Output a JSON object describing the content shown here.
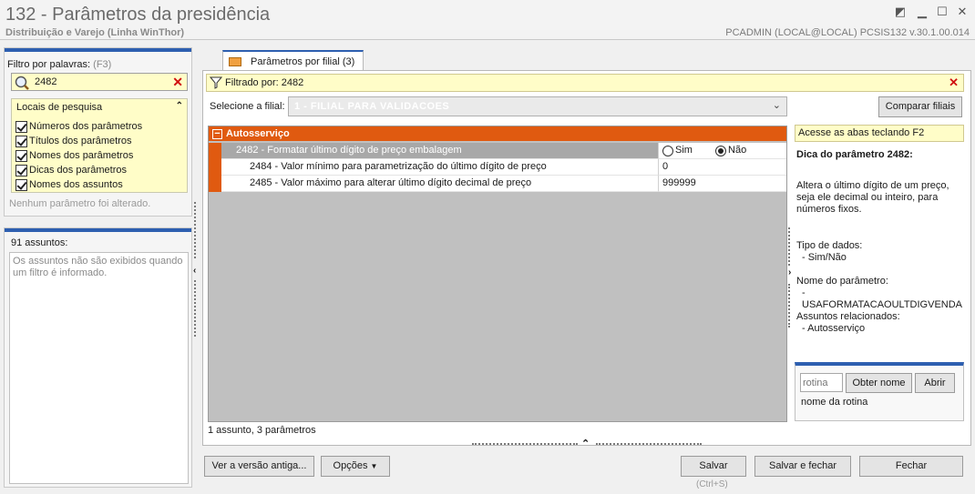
{
  "window": {
    "title": "132 - Parâmetros da presidência",
    "subtitle": "Distribuição e Varejo (Linha WinThor)",
    "user_info": "PCADMIN (LOCAL@LOCAL)   PCSIS132  v.30.1.00.014",
    "controls": [
      "restore-icon",
      "minimize-icon",
      "maximize-icon",
      "close-icon"
    ]
  },
  "left": {
    "filter_label": "Filtro por palavras:",
    "filter_hint": "(F3)",
    "search_value": "2482",
    "locais_title": "Locais de pesquisa",
    "locais_items": [
      "Números dos parâmetros",
      "Títulos dos parâmetros",
      "Nomes dos parâmetros",
      "Dicas dos parâmetros",
      "Nomes dos assuntos"
    ],
    "no_param_changed": "Nenhum parâmetro foi alterado.",
    "assuntos_count": "91 assuntos:",
    "assuntos_note": "Os assuntos não são exibidos quando um filtro é informado."
  },
  "tab": {
    "label": "Parâmetros por filial",
    "count": "(3)"
  },
  "filter_bar": {
    "text": "Filtrado por: 2482"
  },
  "filial": {
    "label": "Selecione a filial:",
    "value": "1 - FILIAL PARA VALIDACOES",
    "compare_button": "Comparar filiais"
  },
  "grid": {
    "group": "Autosserviço",
    "rows": [
      {
        "name": "2482 - Formatar último dígito de preço embalagem",
        "options": [
          "Sim",
          "Não"
        ],
        "selected": "Não"
      },
      {
        "name": "2484 - Valor mínimo para parametrização do último dígito de preço",
        "value": "0"
      },
      {
        "name": "2485 - Valor máximo para alterar último dígito decimal de preço",
        "value": "999999"
      }
    ],
    "status": "1 assunto, 3 parâmetros"
  },
  "help": {
    "shortcut": "Acesse as abas teclando F2",
    "title": "Dica do parâmetro 2482:",
    "description": "Altera o último dígito de um preço, seja ele decimal ou inteiro, para números fixos.",
    "data_type_label": "Tipo de dados:",
    "data_type_value": "- Sim/Não",
    "param_name_label": "Nome do parâmetro:",
    "param_name_value": "- USAFORMATACAOULTDIGVENDA",
    "related_label": "Assuntos relacionados:",
    "related_value": "- Autosserviço"
  },
  "rotina": {
    "placeholder": "rotina",
    "obter_button": "Obter nome",
    "abrir_button": "Abrir",
    "name_label": "nome da rotina"
  },
  "footer": {
    "old_version_button": "Ver a versão antiga...",
    "options_button": "Opções",
    "save_button": "Salvar",
    "save_hint": "(Ctrl+S)",
    "save_close_button": "Salvar e fechar",
    "close_button": "Fechar"
  },
  "colors": {
    "accent": "#2d5fb0",
    "group_header": "#e05a10",
    "highlight_bg": "#fffdc8"
  }
}
